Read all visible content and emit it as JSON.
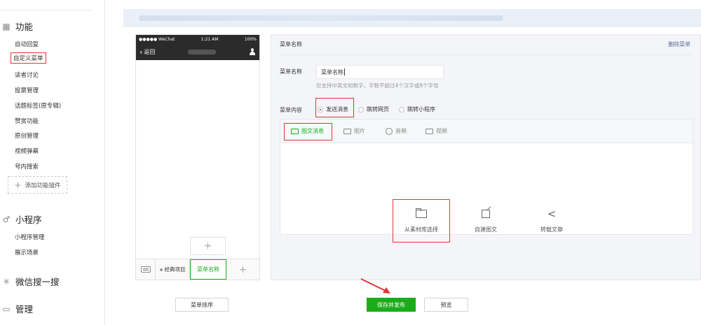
{
  "sidebar": {
    "sections": [
      {
        "label": "功能",
        "icon": "grid-icon"
      },
      {
        "label": "小程序",
        "icon": "mini-program-icon"
      },
      {
        "label": "微信搜一搜",
        "icon": "search-spark-icon"
      },
      {
        "label": "管理",
        "icon": "manage-icon"
      }
    ],
    "feature_items": [
      "自动回复",
      "自定义菜单",
      "读者讨论",
      "投票管理",
      "话题标签(原专辑)",
      "赞赏功能",
      "原创管理",
      "视频弹幕",
      "号内搜索"
    ],
    "add_plugin_label": "添加功能插件",
    "mini_items": [
      "小程序管理",
      "展示场景"
    ]
  },
  "phone": {
    "carrier": "●●●●● WeChat",
    "time": "1:21 AM",
    "battery": "100%",
    "back_label": "返回",
    "menu_classic": "经典项目",
    "menu_selected": "菜单名称",
    "add_symbol": "+"
  },
  "editor": {
    "title": "菜单名称",
    "delete_label": "删除菜单",
    "name_label": "菜单名称",
    "name_value": "菜单名称",
    "hint": "仅支持中英文和数字，字数不超过4个汉字或8个字母",
    "content_label": "菜单内容",
    "options": [
      "发送消息",
      "跳转网页",
      "跳转小程序"
    ],
    "tabs": [
      "图文消息",
      "图片",
      "音频",
      "视频"
    ],
    "choices": [
      "从素材库选择",
      "自建图文",
      "转载文章"
    ]
  },
  "buttons": {
    "sort": "菜单排序",
    "save": "保存并发布",
    "preview": "预览"
  },
  "colors": {
    "accent": "#1aad19",
    "highlight": "#e03636"
  }
}
